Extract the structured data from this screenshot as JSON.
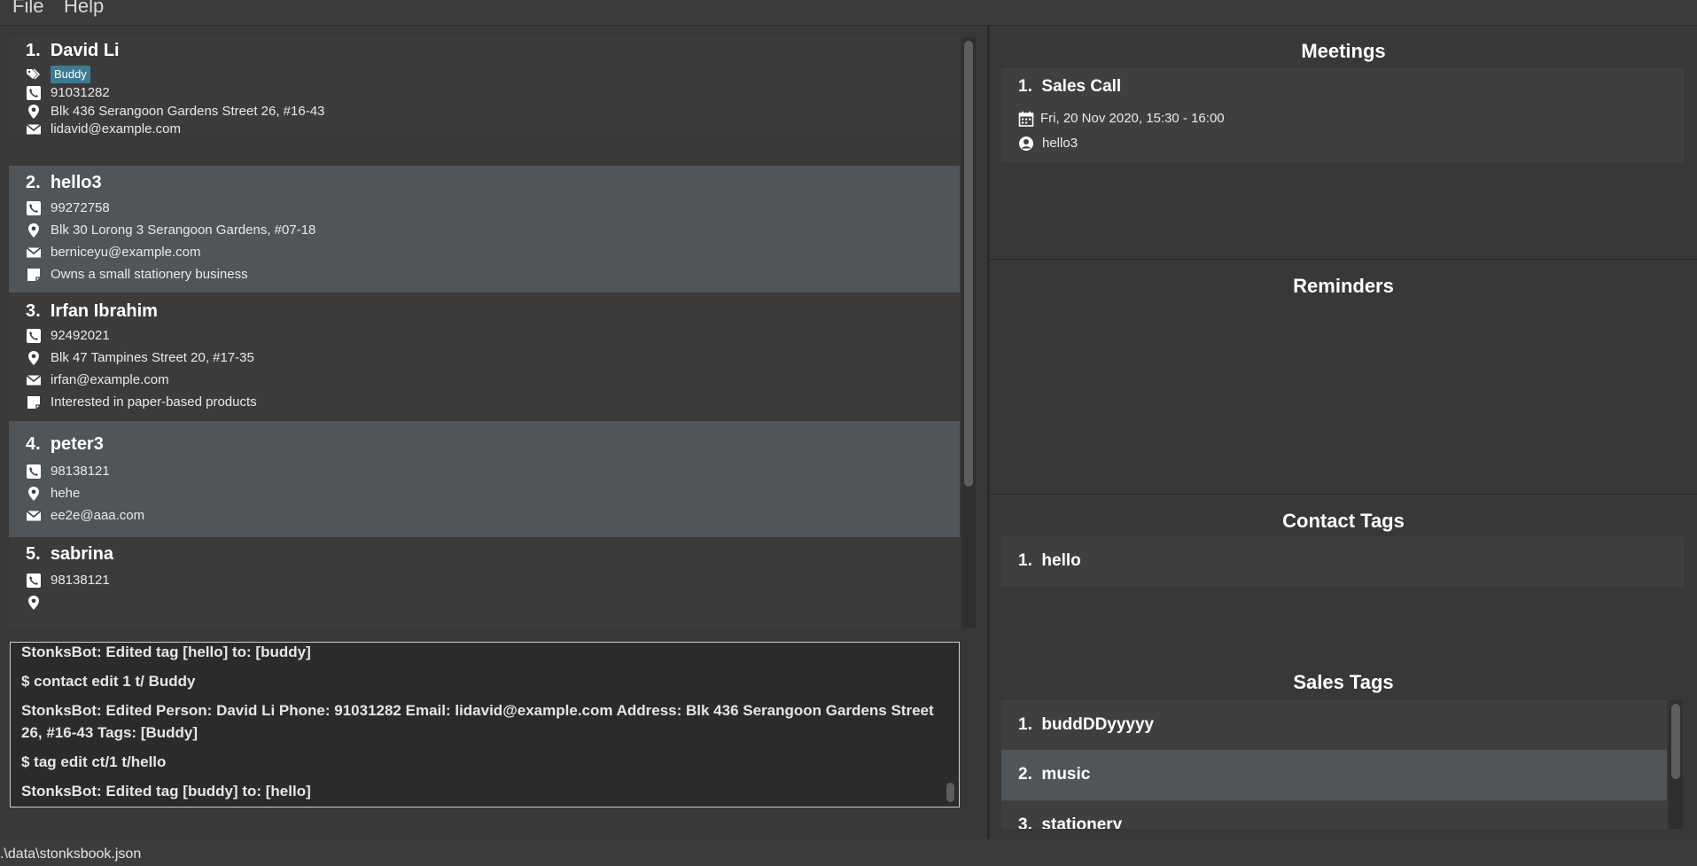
{
  "menu": {
    "file": "File",
    "help": "Help"
  },
  "persons": [
    {
      "index": "1.",
      "name": "David Li",
      "tag": "Buddy",
      "phone": "91031282",
      "address": "Blk 436 Serangoon Gardens Street 26, #16-43",
      "email": "lidavid@example.com"
    },
    {
      "index": "2.",
      "name": "hello3",
      "phone": "99272758",
      "address": "Blk 30 Lorong 3 Serangoon Gardens, #07-18",
      "email": "berniceyu@example.com",
      "remark": "Owns a small stationery business"
    },
    {
      "index": "3.",
      "name": "Irfan Ibrahim",
      "phone": "92492021",
      "address": "Blk 47 Tampines Street 20, #17-35",
      "email": "irfan@example.com",
      "remark": "Interested in paper-based products"
    },
    {
      "index": "4.",
      "name": "peter3",
      "phone": "98138121",
      "address": "hehe",
      "email": "ee2e@aaa.com"
    },
    {
      "index": "5.",
      "name": "sabrina",
      "phone": "98138121"
    }
  ],
  "result_lines": [
    "StonksBot: Edited tag [hello] to: [buddy]",
    "$ contact edit 1 t/ Buddy",
    "StonksBot: Edited Person: David Li Phone: 91031282 Email: lidavid@example.com Address: Blk 436 Serangoon Gardens Street 26, #16-43 Tags: [Buddy]",
    "$ tag edit ct/1 t/hello",
    "StonksBot: Edited tag [buddy] to: [hello]"
  ],
  "status": {
    "path": ".\\data\\stonksbook.json"
  },
  "meetings": {
    "title": "Meetings",
    "items": [
      {
        "index": "1.",
        "name": "Sales Call",
        "datetime": "Fri, 20 Nov 2020, 15:30 - 16:00",
        "contact": "hello3"
      }
    ]
  },
  "reminders": {
    "title": "Reminders"
  },
  "contact_tags": {
    "title": "Contact Tags",
    "items": [
      {
        "index": "1.",
        "label": "hello"
      }
    ]
  },
  "sales_tags": {
    "title": "Sales Tags",
    "items": [
      {
        "index": "1.",
        "label": "buddDDyyyyy"
      },
      {
        "index": "2.",
        "label": "music"
      },
      {
        "index": "3.",
        "label": "stationery"
      }
    ]
  }
}
